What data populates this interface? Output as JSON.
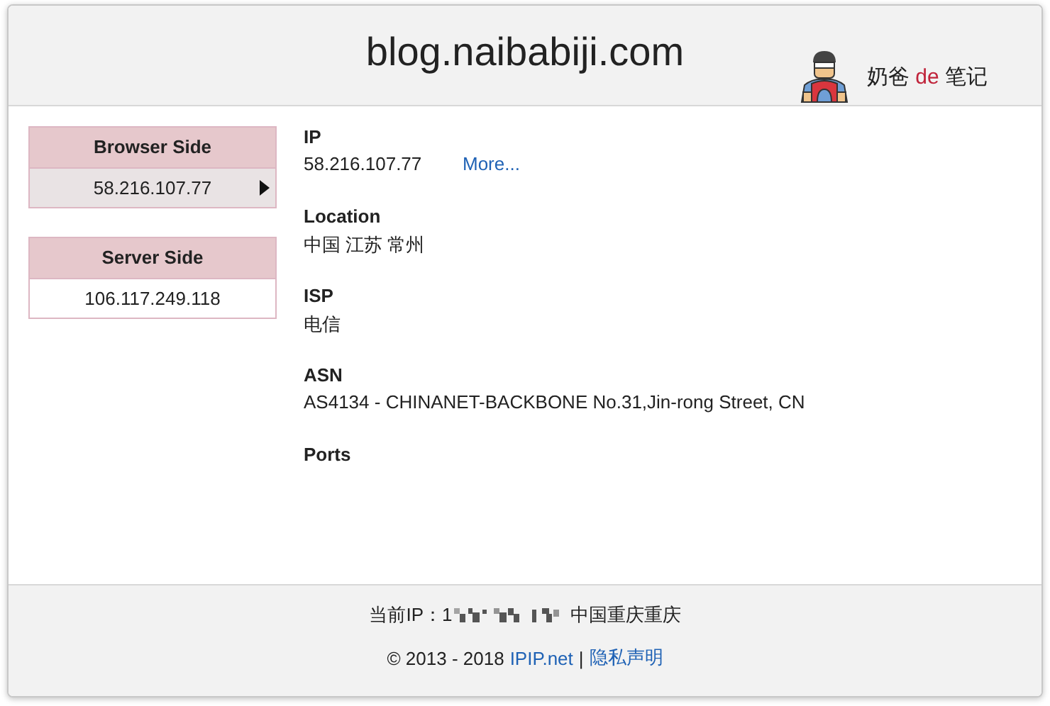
{
  "header": {
    "title": "blog.naibabiji.com",
    "brand": {
      "before": "奶爸",
      "accent": "de",
      "after": "笔记"
    }
  },
  "sides": [
    {
      "title": "Browser Side",
      "ip": "58.216.107.77",
      "selected": true
    },
    {
      "title": "Server Side",
      "ip": "106.117.249.118",
      "selected": false
    }
  ],
  "details": [
    {
      "label": "IP",
      "value": "58.216.107.77",
      "link": "More..."
    },
    {
      "label": "Location",
      "value": "中国 江苏 常州"
    },
    {
      "label": "ISP",
      "value": "电信"
    },
    {
      "label": "ASN",
      "value": "AS4134 - CHINANET-BACKBONE No.31,Jin-rong Street, CN"
    },
    {
      "label": "Ports"
    }
  ],
  "footer": {
    "current_ip_label": "当前IP：1",
    "current_ip_location": "中国重庆重庆",
    "copyright": "© 2013 - 2018",
    "links": [
      "IPIP.net",
      "隐私声明"
    ],
    "separator": "|"
  }
}
